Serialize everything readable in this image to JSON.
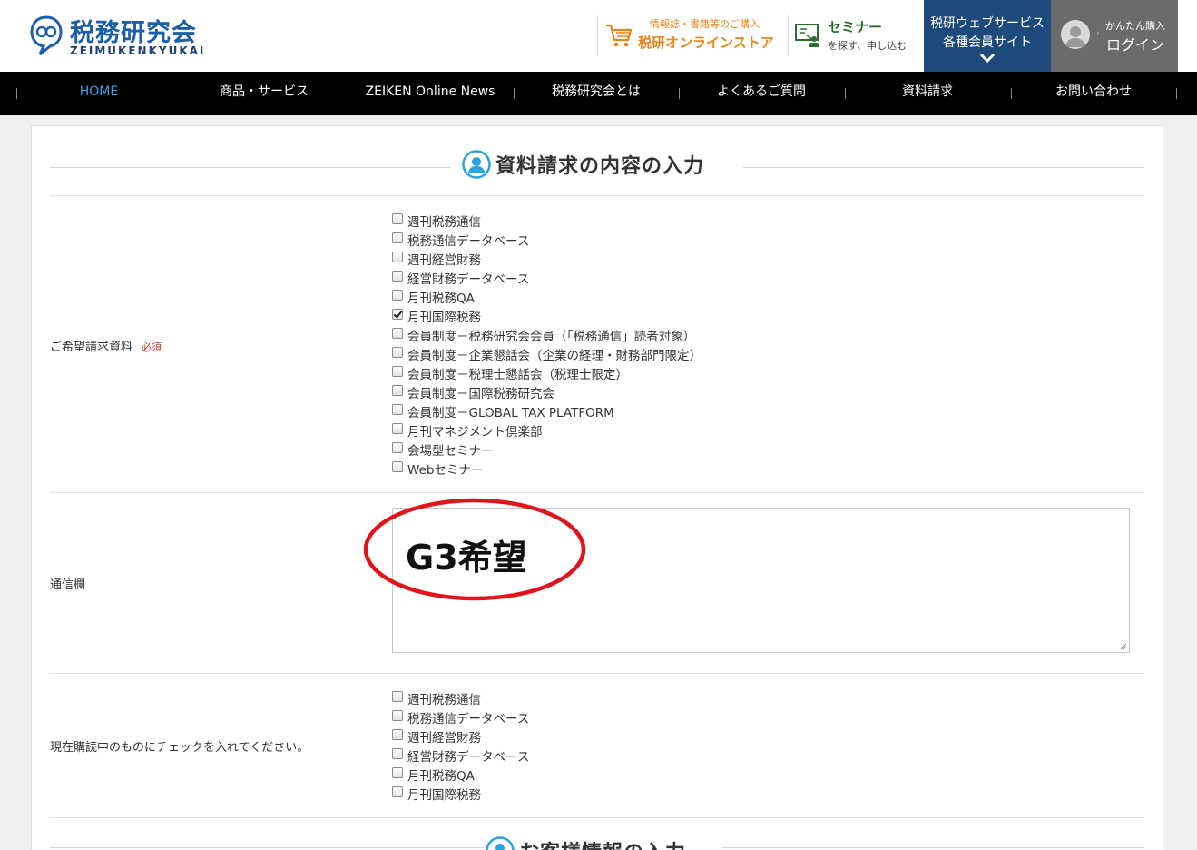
{
  "header": {
    "logo_title": "税務研究会",
    "logo_sub": "ZEIMUKENKYUKAI",
    "store_small": "情報誌・書籍等のご購入",
    "store_big": "税研オンラインストア",
    "seminar_big": "セミナー",
    "seminar_small": "を探す、申し込む",
    "web_line1": "税研ウェブサービス",
    "web_line2": "各種会員サイト",
    "login_small": "かんたん購入",
    "login_big": "ログイン",
    "colors": {
      "brand_blue": "#1c5fa8",
      "store_orange": "#e8841a",
      "seminar_green": "#2b6d2e",
      "web_bg": "#1d4a7a",
      "login_bg": "#6b6b6b"
    }
  },
  "nav": {
    "items": [
      {
        "label": "HOME",
        "active": true
      },
      {
        "label": "商品・サービス",
        "active": false
      },
      {
        "label": "ZEIKEN Online News",
        "active": false
      },
      {
        "label": "税務研究会とは",
        "active": false
      },
      {
        "label": "よくあるご質問",
        "active": false
      },
      {
        "label": "資料請求",
        "active": false
      },
      {
        "label": "お問い合わせ",
        "active": false
      }
    ]
  },
  "form": {
    "section_title": "資料請求の内容の入力",
    "materials": {
      "label": "ご希望請求資料",
      "required": "必須",
      "options": [
        {
          "label": "週刊税務通信",
          "checked": false
        },
        {
          "label": "税務通信データベース",
          "checked": false
        },
        {
          "label": "週刊経営財務",
          "checked": false
        },
        {
          "label": "経営財務データベース",
          "checked": false
        },
        {
          "label": "月刊税務QA",
          "checked": false
        },
        {
          "label": "月刊国際税務",
          "checked": true
        },
        {
          "label": "会員制度－税務研究会会員（「税務通信」読者対象）",
          "checked": false
        },
        {
          "label": "会員制度－企業懇話会（企業の経理・財務部門限定）",
          "checked": false
        },
        {
          "label": "会員制度－税理士懇話会（税理士限定）",
          "checked": false
        },
        {
          "label": "会員制度－国際税務研究会",
          "checked": false
        },
        {
          "label": "会員制度－GLOBAL TAX PLATFORM",
          "checked": false
        },
        {
          "label": "月刊マネジメント倶楽部",
          "checked": false
        },
        {
          "label": "会場型セミナー",
          "checked": false
        },
        {
          "label": "Webセミナー",
          "checked": false
        }
      ]
    },
    "message": {
      "label": "通信欄",
      "value": "G3希望",
      "annotation_color": "#e0141c"
    },
    "subscribed": {
      "label": "現在購読中のものにチェックを入れてください。",
      "options": [
        {
          "label": "週刊税務通信",
          "checked": false
        },
        {
          "label": "税務通信データベース",
          "checked": false
        },
        {
          "label": "週刊経営財務",
          "checked": false
        },
        {
          "label": "経営財務データベース",
          "checked": false
        },
        {
          "label": "月刊税務QA",
          "checked": false
        },
        {
          "label": "月刊国際税務",
          "checked": false
        }
      ]
    },
    "next_section_title": "お客様情報の入力"
  }
}
